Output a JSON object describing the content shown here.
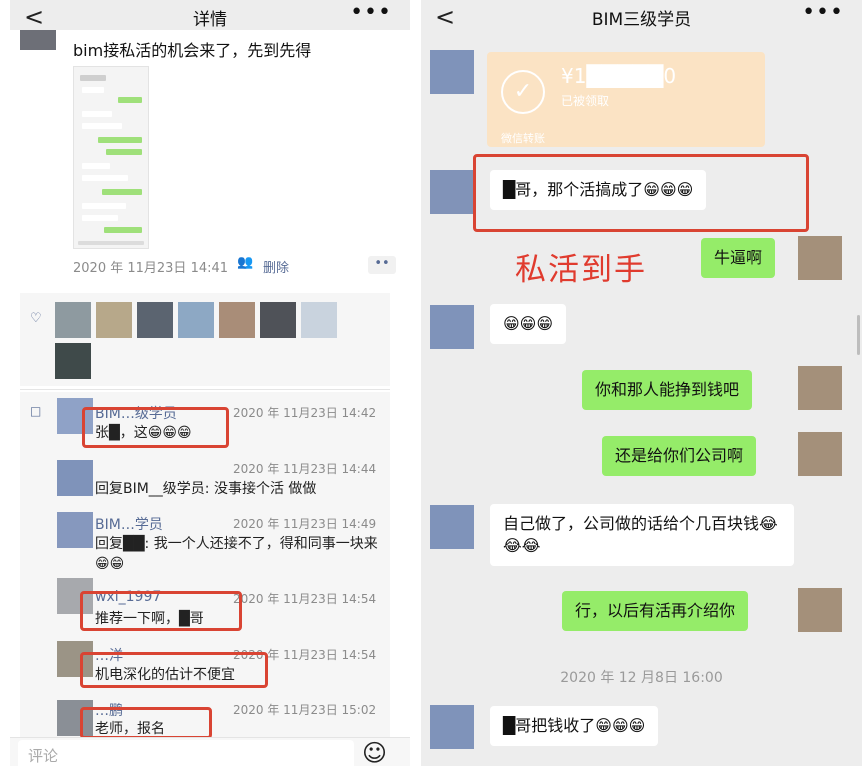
{
  "left": {
    "header": {
      "title": "详情",
      "back_glyph": "<",
      "more_glyph": "•••"
    },
    "post": {
      "text": "bim接私活的机会来了，先到先得",
      "timestamp": "2020 年 11月23日 14:41",
      "visibility_icon": "people-icon",
      "delete_label": "删除",
      "actions_glyph": "••"
    },
    "likes": {
      "icon": "heart-icon"
    },
    "comments_icon": "comment-icon",
    "comments": [
      {
        "name": "BIM…级学员",
        "time": "2020 年 11月23日 14:42",
        "text": "张█，这😁😁😁"
      },
      {
        "name": "",
        "time": "2020 年 11月23日 14:44",
        "text": "回复BIM__级学员: 没事接个活 做做"
      },
      {
        "name": "BIM…学员",
        "time": "2020 年 11月23日 14:49",
        "text": "回复██: 我一个人还接不了，得和同事一块来😁😁"
      },
      {
        "name": "wxi_1997",
        "time": "2020 年 11月23日 14:54",
        "text": "推荐一下啊，█哥"
      },
      {
        "name": "…洋",
        "time": "2020 年 11月23日 14:54",
        "text": "机电深化的估计不便宜"
      },
      {
        "name": "…鹏",
        "time": "2020 年 11月23日 15:02",
        "text": "老师，报名"
      }
    ],
    "input": {
      "placeholder": "评论",
      "emoji_glyph": "☺"
    }
  },
  "right": {
    "header": {
      "title": "BIM三级学员",
      "back_glyph": "<",
      "more_glyph": "•••"
    },
    "transfer": {
      "amount": "¥1█████0",
      "status": "已被领取",
      "source": "微信转账",
      "check_glyph": "✓"
    },
    "caption": "私活到手",
    "messages": [
      {
        "dir": "in",
        "text": "█哥，那个活搞成了😁😁😁"
      },
      {
        "dir": "out",
        "text": "牛逼啊"
      },
      {
        "dir": "in",
        "text": "😁😁😁"
      },
      {
        "dir": "out",
        "text": "你和那人能挣到钱吧"
      },
      {
        "dir": "out",
        "text": "还是给你们公司啊"
      },
      {
        "dir": "in",
        "text": "自己做了，公司做的话给个几百块钱😂😂😂"
      },
      {
        "dir": "out",
        "text": "行，以后有活再介绍你"
      },
      {
        "dir": "in",
        "text": "█哥把钱收了😁😁😁"
      }
    ],
    "timestamp": "2020 年 12 月8日 16:00"
  }
}
